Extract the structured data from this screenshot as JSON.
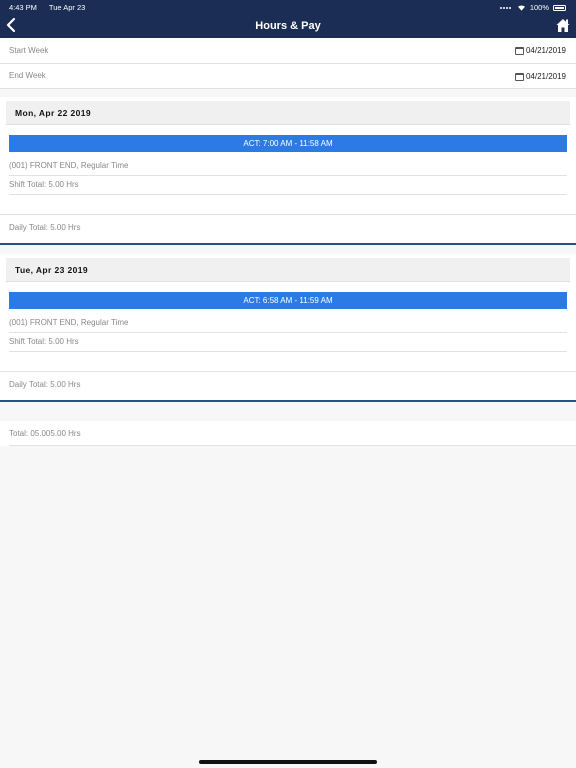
{
  "status_bar": {
    "time": "4:43 PM",
    "date": "Tue Apr 23",
    "battery": "100%"
  },
  "header": {
    "title": "Hours & Pay",
    "back_icon": "chevron-left-icon",
    "home_icon": "home-icon"
  },
  "filters": {
    "start_week": {
      "label": "Start Week",
      "value": "04/21/2019"
    },
    "end_week": {
      "label": "End Week",
      "value": "04/21/2019"
    }
  },
  "days": [
    {
      "date": "Mon, Apr 22 2019",
      "act": "ACT: 7:00 AM - 11:58 AM",
      "job": "(001) FRONT END, Regular Time",
      "shift_total": "Shift Total: 5.00 Hrs",
      "daily_total": "Daily Total: 5.00 Hrs"
    },
    {
      "date": "Tue, Apr 23 2019",
      "act": "ACT: 6:58 AM - 11:59 AM",
      "job": "(001) FRONT END, Regular Time",
      "shift_total": "Shift Total: 5.00 Hrs",
      "daily_total": "Daily Total: 5.00 Hrs"
    }
  ],
  "grand_total": "Total: 05.005.00 Hrs",
  "colors": {
    "navbar": "#1b2d55",
    "accent": "#2c7be5",
    "divider": "#2d4f86"
  }
}
